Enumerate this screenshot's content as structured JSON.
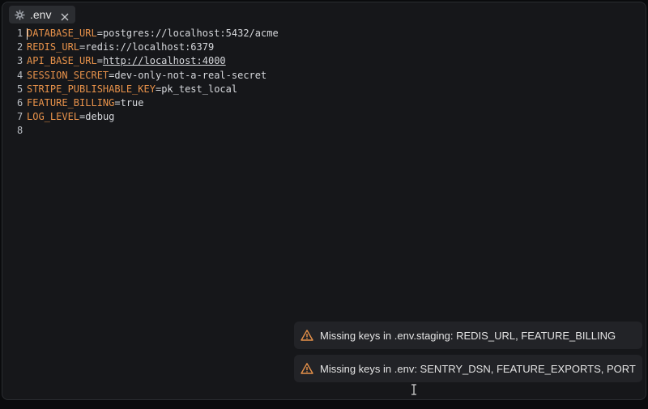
{
  "tab": {
    "label": ".env",
    "icon": "gear-icon",
    "close_icon": "close-icon"
  },
  "editor": {
    "lines": [
      {
        "num": "1",
        "key": "DATABASE_URL",
        "eq": "=",
        "value": "postgres://localhost:5432/acme"
      },
      {
        "num": "2",
        "key": "REDIS_URL",
        "eq": "=",
        "value": "redis://localhost:6379"
      },
      {
        "num": "3",
        "key": "API_BASE_URL",
        "eq": "=",
        "value": "http://localhost:4000"
      },
      {
        "num": "4",
        "key": "SESSION_SECRET",
        "eq": "=",
        "value": "dev-only-not-a-real-secret"
      },
      {
        "num": "5",
        "key": "STRIPE_PUBLISHABLE_KEY",
        "eq": "=",
        "value": "pk_test_local"
      },
      {
        "num": "6",
        "key": "FEATURE_BILLING",
        "eq": "=",
        "value": "true"
      },
      {
        "num": "7",
        "key": "LOG_LEVEL",
        "eq": "=",
        "value": "debug"
      },
      {
        "num": "8",
        "key": "",
        "eq": "",
        "value": ""
      }
    ]
  },
  "notifications": [
    {
      "icon": "warning-icon",
      "message": "Missing keys in .env.staging: REDIS_URL, FEATURE_BILLING"
    },
    {
      "icon": "warning-icon",
      "message": "Missing keys in .env: SENTRY_DSN, FEATURE_EXPORTS, PORT"
    }
  ],
  "colors": {
    "key": "#e8924a",
    "warning": "#e8924a",
    "background": "#16171a"
  }
}
